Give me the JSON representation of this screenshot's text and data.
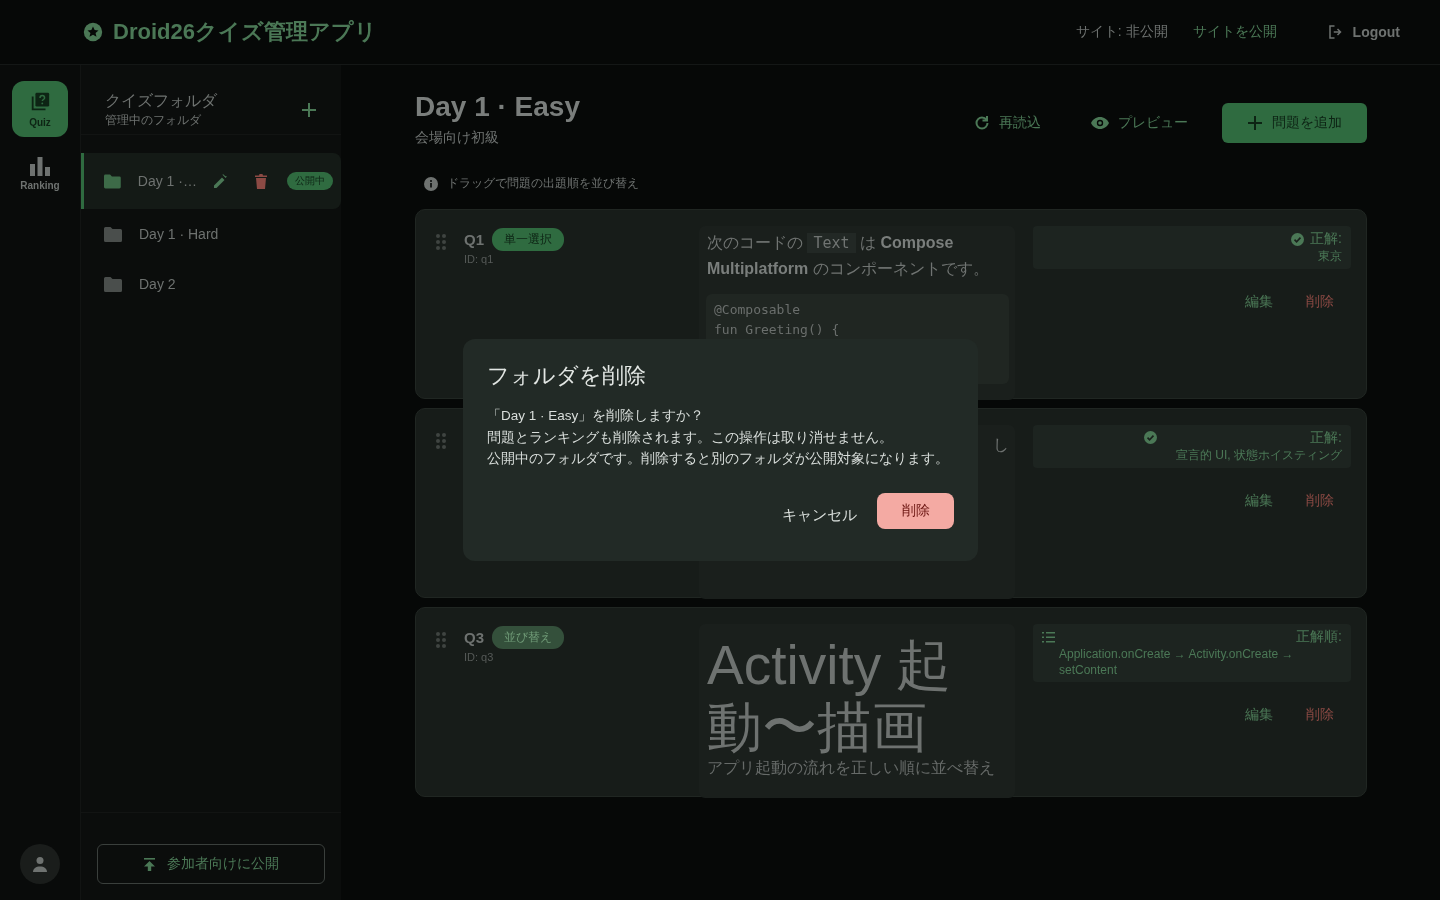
{
  "app": {
    "title": "Droid26クイズ管理アプリ"
  },
  "header": {
    "site_status": "サイト: 非公開",
    "publish_site": "サイトを公開",
    "logout": "Logout"
  },
  "rail": [
    {
      "label": "Quiz",
      "selected": true
    },
    {
      "label": "Ranking",
      "selected": false
    }
  ],
  "folders": {
    "title": "クイズフォルダ",
    "subtitle": "管理中のフォルダ",
    "items": [
      {
        "name": "Day 1 ·…",
        "selected": true,
        "badge": "公開中"
      },
      {
        "name": "Day 1 · Hard",
        "selected": false
      },
      {
        "name": "Day 2",
        "selected": false
      }
    ],
    "publish_button": "参加者向けに公開"
  },
  "page": {
    "title": "Day 1 · Easy",
    "subtitle": "会場向け初級",
    "reload": "再読込",
    "preview": "プレビュー",
    "add": "問題を追加",
    "hint": "ドラッグで問題の出題順を並び替え"
  },
  "questions": [
    {
      "kind": "text",
      "number": "Q1",
      "type": "単一選択",
      "id": "ID: q1",
      "parts": [
        {
          "kind": "text",
          "text": "次のコードの"
        },
        {
          "kind": "code",
          "text": "Text"
        },
        {
          "kind": "text",
          "text": "は **Compose Multiplatform** のコンポーネントです。"
        }
      ],
      "code": [
        "@Composable",
        "fun Greeting() {"
      ],
      "answer": {
        "kind": "single",
        "label": "正解:",
        "value": "東京"
      },
      "edit": "編集",
      "delete": "削除"
    },
    {
      "kind": "hidden",
      "fragment": "し",
      "answer": {
        "kind": "multi",
        "label": "正解:",
        "value": "宣言的 UI, 状態ホイスティング"
      },
      "edit": "編集",
      "delete": "削除"
    },
    {
      "kind": "title",
      "number": "Q3",
      "type": "並び替え",
      "id": "ID: q3",
      "title": "Activity 起動〜描画",
      "subtitle": "アプリ起動の流れを正しい順に並べ替え",
      "answer": {
        "kind": "order",
        "label": "正解順:",
        "value": "Application.onCreate → Activity.onCreate → setContent"
      },
      "edit": "編集",
      "delete": "削除"
    }
  ],
  "dialog": {
    "title": "フォルダを削除",
    "lines": [
      "「Day 1 · Easy」を削除しますか？",
      "問題とランキングも削除されます。この操作は取り消せません。",
      "公開中のフォルダです。削除すると別のフォルダが公開対象になります。"
    ],
    "cancel": "キャンセル",
    "confirm": "削除"
  }
}
